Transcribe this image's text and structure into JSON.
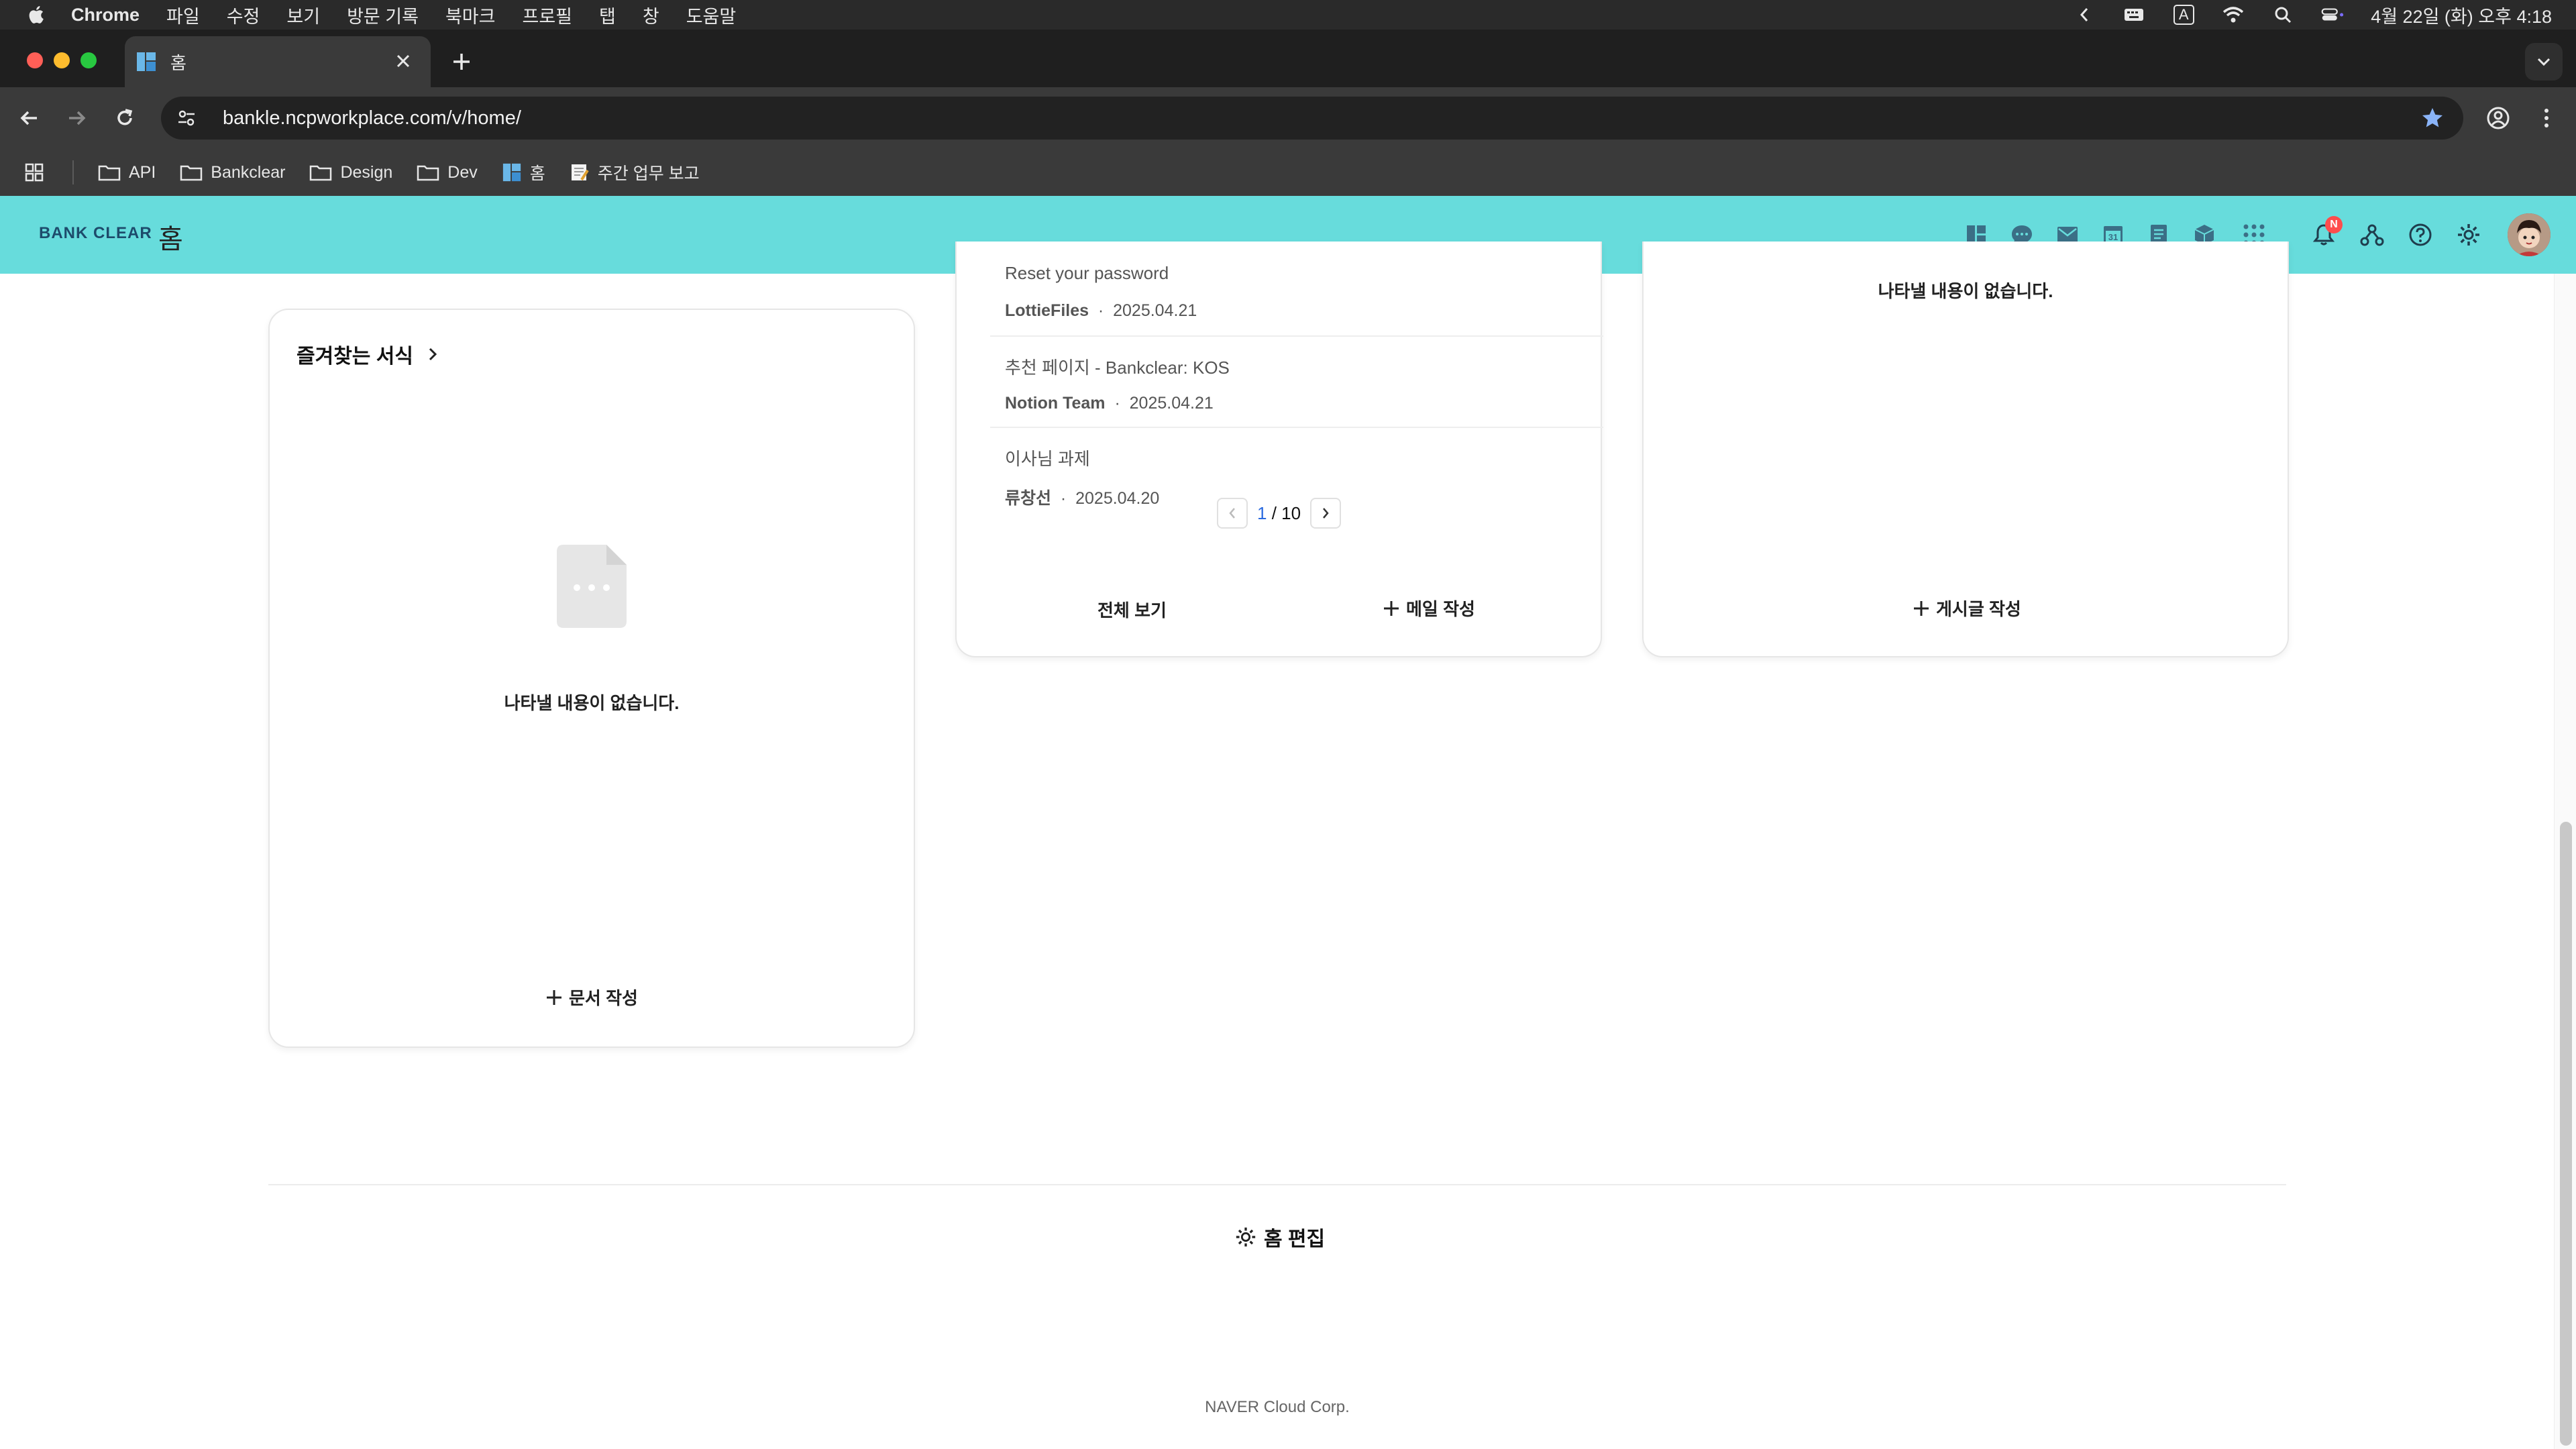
{
  "menubar": {
    "app": "Chrome",
    "items": [
      "파일",
      "수정",
      "보기",
      "방문 기록",
      "북마크",
      "프로필",
      "탭",
      "창",
      "도움말"
    ],
    "clock": "4월 22일 (화) 오후 4:18",
    "input_indicator": "A"
  },
  "browser": {
    "tab_title": "홈",
    "url": "bankle.ncpworkplace.com/v/home/",
    "bookmarks": [
      "API",
      "Bankclear",
      "Design",
      "Dev",
      "홈",
      "주간 업무 보고"
    ]
  },
  "header": {
    "logo_left": "BANK",
    "logo_right": "CLEAR",
    "page_title": "홈",
    "notification_badge": "N",
    "accent_color": "#67dcdc"
  },
  "favorites_card": {
    "title": "즐겨찾는 서식",
    "empty_text": "나타낼 내용이 없습니다.",
    "action": "문서 작성"
  },
  "mail_card": {
    "items": [
      {
        "subject": "Reset your password",
        "sender": "LottieFiles",
        "date": "2025.04.21"
      },
      {
        "subject": "추천 페이지 - Bankclear: KOS",
        "sender": "Notion Team",
        "date": "2025.04.21"
      },
      {
        "subject": "이사님 과제",
        "sender": "류창선",
        "date": "2025.04.20"
      }
    ],
    "page_current": "1",
    "page_total": "/ 10",
    "view_all": "전체 보기",
    "compose": "메일 작성"
  },
  "board_card": {
    "empty_text": "나타낼 내용이 없습니다.",
    "action": "게시글 작성"
  },
  "footer": {
    "home_edit": "홈 편집",
    "company": "NAVER Cloud Corp."
  }
}
